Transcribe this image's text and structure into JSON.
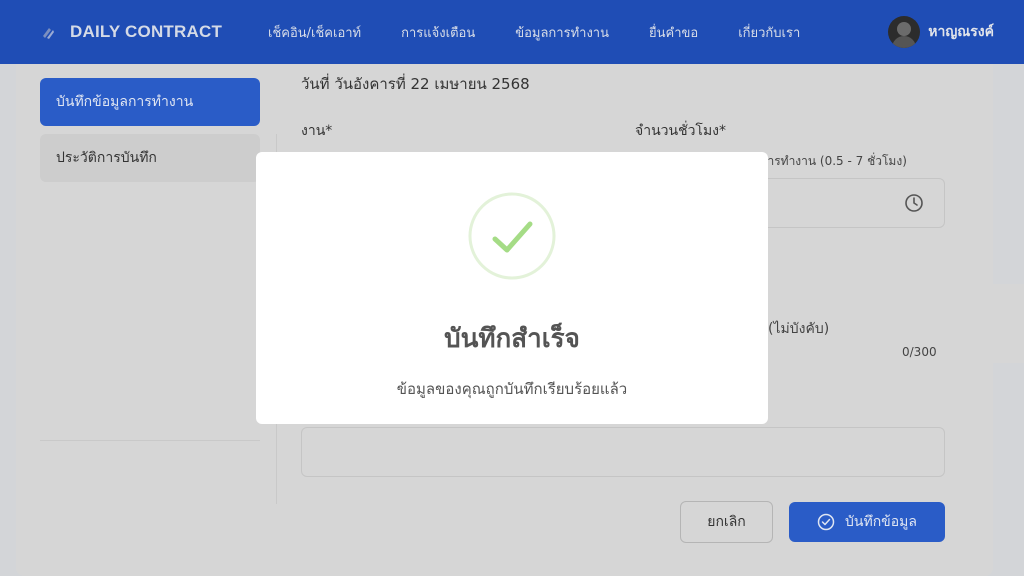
{
  "nav": {
    "brand": "DAILY CONTRACT",
    "links": [
      "เช็คอิน/เช็คเอาท์",
      "การแจ้งเตือน",
      "ข้อมูลการทำงาน",
      "ยื่นคำขอ",
      "เกี่ยวกับเรา"
    ],
    "user_name": "หาญณรงค์"
  },
  "sidebar": {
    "items": [
      {
        "label": "บันทึกข้อมูลการทำงาน",
        "active": true
      },
      {
        "label": "ประวัติการบันทึก",
        "active": false
      }
    ]
  },
  "form": {
    "date_line": "วันที่ วันอังคารที่ 22 เมษายน 2568",
    "job_label": "งาน*",
    "hours_label": "จำนวนชั่วโมง*",
    "hours_hint": "นการทำงาน (0.5 - 7 ชั่วโมง)",
    "optional_label": "(ไม่บังคับ)",
    "char_counter": "0/300",
    "cancel_label": "ยกเลิก",
    "save_label": "บันทึกข้อมูล"
  },
  "modal": {
    "title": "บันทึกสำเร็จ",
    "message": "ข้อมูลของคุณถูกบันทึกเรียบร้อยแล้ว"
  },
  "colors": {
    "nav_bg": "#1f4db5",
    "accent": "#2a5cc7",
    "success": "#a5dc86"
  }
}
